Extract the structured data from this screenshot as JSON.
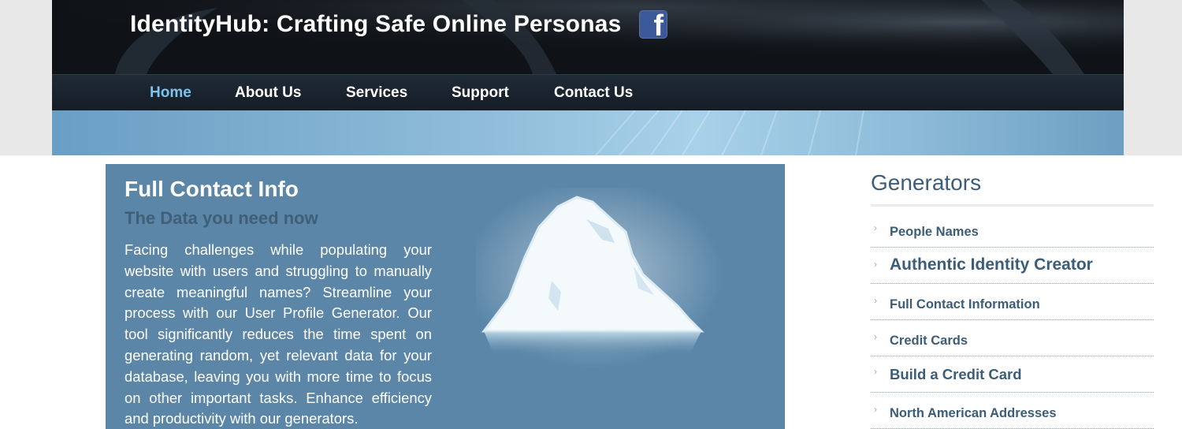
{
  "header": {
    "title": "IdentityHub: Crafting Safe Online Personas",
    "social_icon": "facebook-icon",
    "social_glyph": "f"
  },
  "nav": {
    "items": [
      {
        "label": "Home",
        "active": true
      },
      {
        "label": "About Us",
        "active": false
      },
      {
        "label": "Services",
        "active": false
      },
      {
        "label": "Support",
        "active": false
      },
      {
        "label": "Contact Us",
        "active": false
      }
    ]
  },
  "main": {
    "title": "Full Contact Info",
    "subtitle": "The Data you need now",
    "body": "Facing challenges while populating your website with users and struggling to manually create meaningful names? Streamline your process with our User Profile Generator. Our tool significantly reduces the time spent on generating random, yet relevant data for your database, leaving you with more time to focus on other important tasks. Enhance efficiency and productivity with our generators."
  },
  "sidebar": {
    "title": "Generators",
    "items": [
      {
        "label": "People Names"
      },
      {
        "label": "Authentic Identity Creator"
      },
      {
        "label": "Full Contact Information"
      },
      {
        "label": "Credit Cards"
      },
      {
        "label": "Build a Credit Card"
      },
      {
        "label": "North American Addresses"
      }
    ]
  },
  "colors": {
    "accent": "#7dc3ec",
    "panel": "#5b86a8",
    "sidebar_text": "#3b5d78",
    "facebook": "#3b5998"
  }
}
